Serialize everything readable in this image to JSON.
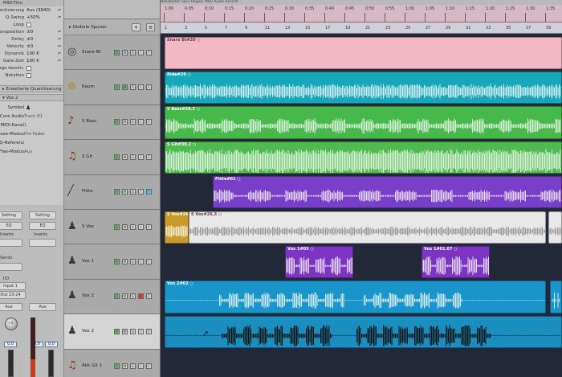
{
  "window": {
    "title": "MIDI-Thru"
  },
  "inspector": {
    "params": [
      {
        "label": "Quantisierung",
        "value": "Aus (3840)"
      },
      {
        "label": "Q-Swing",
        "value": "+50%"
      },
      {
        "label": "Loop",
        "value": ""
      },
      {
        "label": "Transposition",
        "value": "±0"
      },
      {
        "label": "Delay",
        "value": "±0"
      },
      {
        "label": "Velocity",
        "value": "±0"
      },
      {
        "label": "Dynamik",
        "value": "100 K"
      },
      {
        "label": "Gate-Zeit",
        "value": "100 K"
      },
      {
        "label": "Lage beschr.",
        "value": ""
      },
      {
        "label": "Notation",
        "value": ""
      }
    ],
    "advanced_quantize": "Erweiterte Quantisierung",
    "track_name": "Vox 2",
    "track_params": [
      {
        "label": "Symbol",
        "value": ""
      },
      {
        "label": "Core Audio",
        "value": "Track 81"
      },
      {
        "label": "MIDI-Kanal",
        "value": "1"
      },
      {
        "label": "Freeze-Modus",
        "value": "Pre-Fader"
      },
      {
        "label": "Q-Referenz",
        "value": ""
      },
      {
        "label": "Flex-Modus",
        "value": "Aus"
      }
    ],
    "strip": {
      "setting_left": "Setting",
      "setting_right": "Setting",
      "eq_left": "EQ",
      "eq_right": "EQ",
      "inserts_left": "Inserts",
      "inserts_right": "Inserts",
      "sends": "Sends",
      "io": "I/O",
      "input": "Input 1",
      "output": "Out 23-24",
      "auto_left": "Aus",
      "auto_right": "Aus",
      "pan_value": "+0",
      "vol_left": "0,0",
      "vol_mid": "0,0",
      "vol_right": "0,0"
    }
  },
  "tracklist": {
    "global_tracks_label": "Globale Spuren",
    "tracks": [
      {
        "name": "Snare Bt",
        "icon": "snare-icon",
        "selected": false
      },
      {
        "name": "Raum",
        "icon": "cymbal-icon",
        "selected": false
      },
      {
        "name": "S Bass",
        "icon": "bass-guitar-icon",
        "selected": false
      },
      {
        "name": "S Git",
        "icon": "guitar-icon",
        "selected": false
      },
      {
        "name": "Flöte",
        "icon": "flute-icon",
        "selected": false
      },
      {
        "name": "S Vox",
        "icon": "singer-icon",
        "selected": false
      },
      {
        "name": "Vox 1",
        "icon": "singer-icon",
        "selected": false
      },
      {
        "name": "Vox 2",
        "icon": "singer-icon",
        "selected": false
      },
      {
        "name": "Vox 2",
        "icon": "singer-icon",
        "selected": true
      },
      {
        "name": "Akk Git 1",
        "icon": "guitar-icon",
        "selected": false
      }
    ]
  },
  "arrange": {
    "topbar": "Bearbeiten   Spur   Region   MIDI   Audio   Ansicht",
    "ruler_bars": [
      "1:00",
      "0:05",
      "0:10",
      "0:15",
      "0:20",
      "0:25",
      "0:30",
      "0:35",
      "0:40",
      "0:45",
      "0:50",
      "0:55",
      "1:00",
      "1:05",
      "1:10",
      "1:15",
      "1:20",
      "1:25",
      "1:30",
      "1:35"
    ],
    "ruler_bars_lower": [
      "1",
      "3",
      "5",
      "7",
      "9",
      "11",
      "13",
      "15",
      "17",
      "19",
      "21",
      "23",
      "25",
      "27",
      "29",
      "31",
      "33",
      "35",
      "37",
      "39"
    ],
    "regions": [
      {
        "lane": 0,
        "label": "Snare Bt#20 ○",
        "color": "#f2b8c6",
        "start": 0.01,
        "end": 1.0,
        "wave": "none",
        "dark": true
      },
      {
        "lane": 1,
        "label": "Ride#29 ○",
        "color": "#17a7b8",
        "start": 0.01,
        "end": 1.0,
        "wave": "dense",
        "dark": false
      },
      {
        "lane": 2,
        "label": "S Bass#28.2 ○",
        "color": "#47b84a",
        "start": 0.01,
        "end": 1.0,
        "wave": "bass",
        "dark": false
      },
      {
        "lane": 3,
        "label": "S Git#30.2 ○",
        "color": "#4fbb4f",
        "start": 0.01,
        "end": 1.0,
        "wave": "guitar",
        "dark": false
      },
      {
        "lane": 4,
        "label": "Flöte#01 ○",
        "color": "#7a3fc8",
        "start": 0.13,
        "end": 1.0,
        "wave": "flute",
        "dark": false
      },
      {
        "lane": 5,
        "label": "S Vox#26",
        "color": "#c89a2a",
        "start": 0.01,
        "end": 0.07,
        "wave": "voxA",
        "dark": false
      },
      {
        "lane": 5,
        "label": "S Vox#26.3 ○",
        "color": "#e8e8e8",
        "start": 0.07,
        "end": 0.96,
        "wave": "voxB",
        "dark": true
      },
      {
        "lane": 5,
        "label": "",
        "color": "#e8e8e8",
        "start": 0.965,
        "end": 1.0,
        "wave": "voxB",
        "dark": true
      },
      {
        "lane": 6,
        "label": "Vox 1#03 ○",
        "color": "#7c35c2",
        "start": 0.31,
        "end": 0.48,
        "wave": "vox1",
        "dark": false
      },
      {
        "lane": 6,
        "label": "Vox 1#01.07 ○",
        "color": "#7c35c2",
        "start": 0.65,
        "end": 0.82,
        "wave": "vox1",
        "dark": false
      },
      {
        "lane": 7,
        "label": "Vox 2#02 ○",
        "color": "#1a95c9",
        "start": 0.01,
        "end": 0.96,
        "wave": "vox2",
        "dark": false
      },
      {
        "lane": 7,
        "label": "",
        "color": "#1a95c9",
        "start": 0.97,
        "end": 1.0,
        "wave": "vox2",
        "dark": false
      },
      {
        "lane": 8,
        "label": "",
        "color": "#1b8dbf",
        "start": 0.01,
        "end": 1.0,
        "wave": "vox2dark",
        "dark": false
      }
    ]
  }
}
